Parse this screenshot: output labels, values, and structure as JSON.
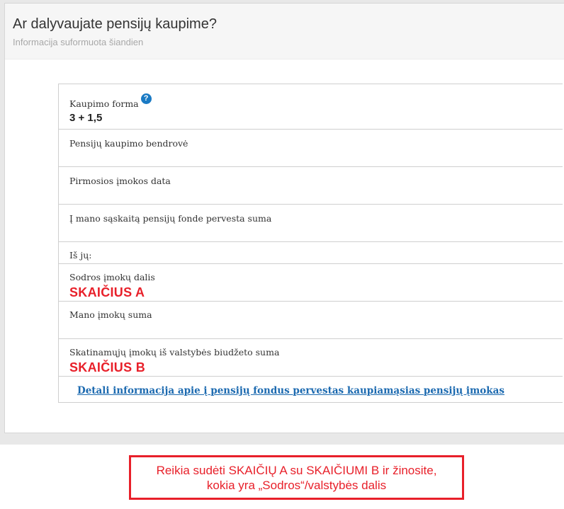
{
  "panel": {
    "title": "Ar dalyvaujate pensijų kaupime?",
    "subtitle": "Informacija suformuota šiandien"
  },
  "rows": {
    "kaupimo_forma": {
      "label": "Kaupimo forma",
      "value": "3 + 1,5",
      "help_icon": "question-circle-icon",
      "help_symbol": "?"
    },
    "bendrove": {
      "label": "Pensijų kaupimo bendrovė",
      "value": ""
    },
    "pirmosios_data": {
      "label": "Pirmosios įmokos data",
      "value": ""
    },
    "pervesta_suma": {
      "label": "Į mano sąskaitą pensijų fonde pervesta suma",
      "value": ""
    },
    "is_ju": {
      "label": "Iš jų:"
    },
    "sodros_dalis": {
      "label": "Sodros įmokų dalis",
      "value": "SKAIČIUS A"
    },
    "mano_suma": {
      "label": "Mano įmokų suma",
      "value": ""
    },
    "skatinamuju": {
      "label": "Skatinamųjų įmokų iš valstybės biudžeto suma",
      "value": "SKAIČIUS B"
    }
  },
  "detail_link": "Detali informacija apie į pensijų fondus pervestas kaupiamąsias pensijų įmokas",
  "note": {
    "line1": "Reikia sudėti SKAIČIŲ A su SKAIČIUMI B ir žinosite,",
    "line2": "kokia yra „Sodros“/valstybės dalis"
  },
  "colors": {
    "highlight_red": "#e8202a",
    "link_blue": "#1c6ab0",
    "help_icon_blue": "#1a7ac4"
  }
}
